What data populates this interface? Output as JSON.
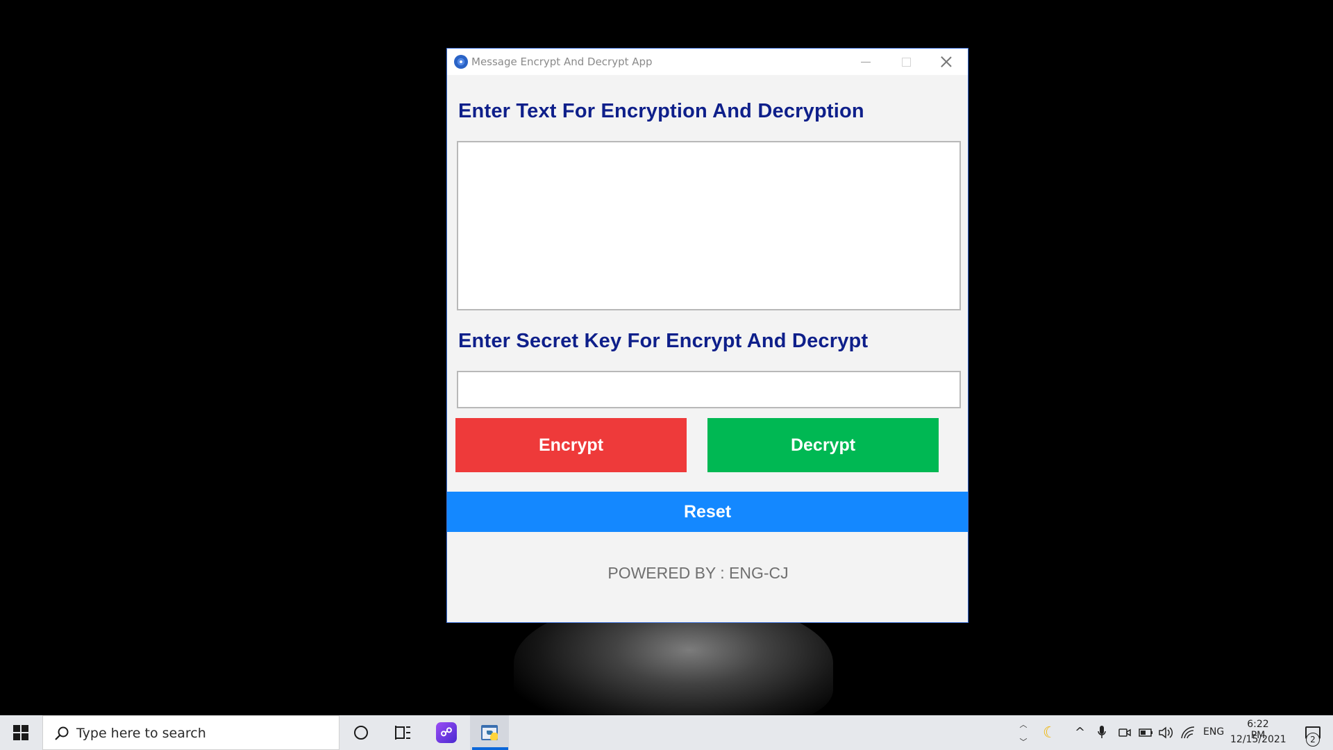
{
  "window": {
    "title": "Message Encrypt And Decrypt App",
    "minimize_glyph": "—",
    "close_glyph": "✕"
  },
  "form": {
    "text_heading": "Enter Text For Encryption And Decryption",
    "message_value": "",
    "key_heading": "Enter Secret Key For Encrypt And Decrypt",
    "key_value": ""
  },
  "buttons": {
    "encrypt_label": "Encrypt",
    "decrypt_label": "Decrypt",
    "reset_label": "Reset"
  },
  "colors": {
    "heading": "#0e1f8a",
    "encrypt": "#ee3a3a",
    "decrypt": "#00b853",
    "reset": "#1488ff"
  },
  "footer": {
    "text": "POWERED BY : ENG-CJ"
  },
  "taskbar": {
    "search_placeholder": "Type here to search",
    "language": "ENG",
    "time": "6:22 PM",
    "date": "12/15/2021",
    "notification_count": "2",
    "icons": [
      "windows-start-icon",
      "search-icon",
      "cortana-icon",
      "task-view-icon",
      "app-launcher-icon",
      "python-icon",
      "moon-icon",
      "chevron-up-icon",
      "microphone-icon",
      "camera-icon",
      "battery-icon",
      "volume-icon",
      "wifi-icon",
      "notification-icon"
    ]
  }
}
